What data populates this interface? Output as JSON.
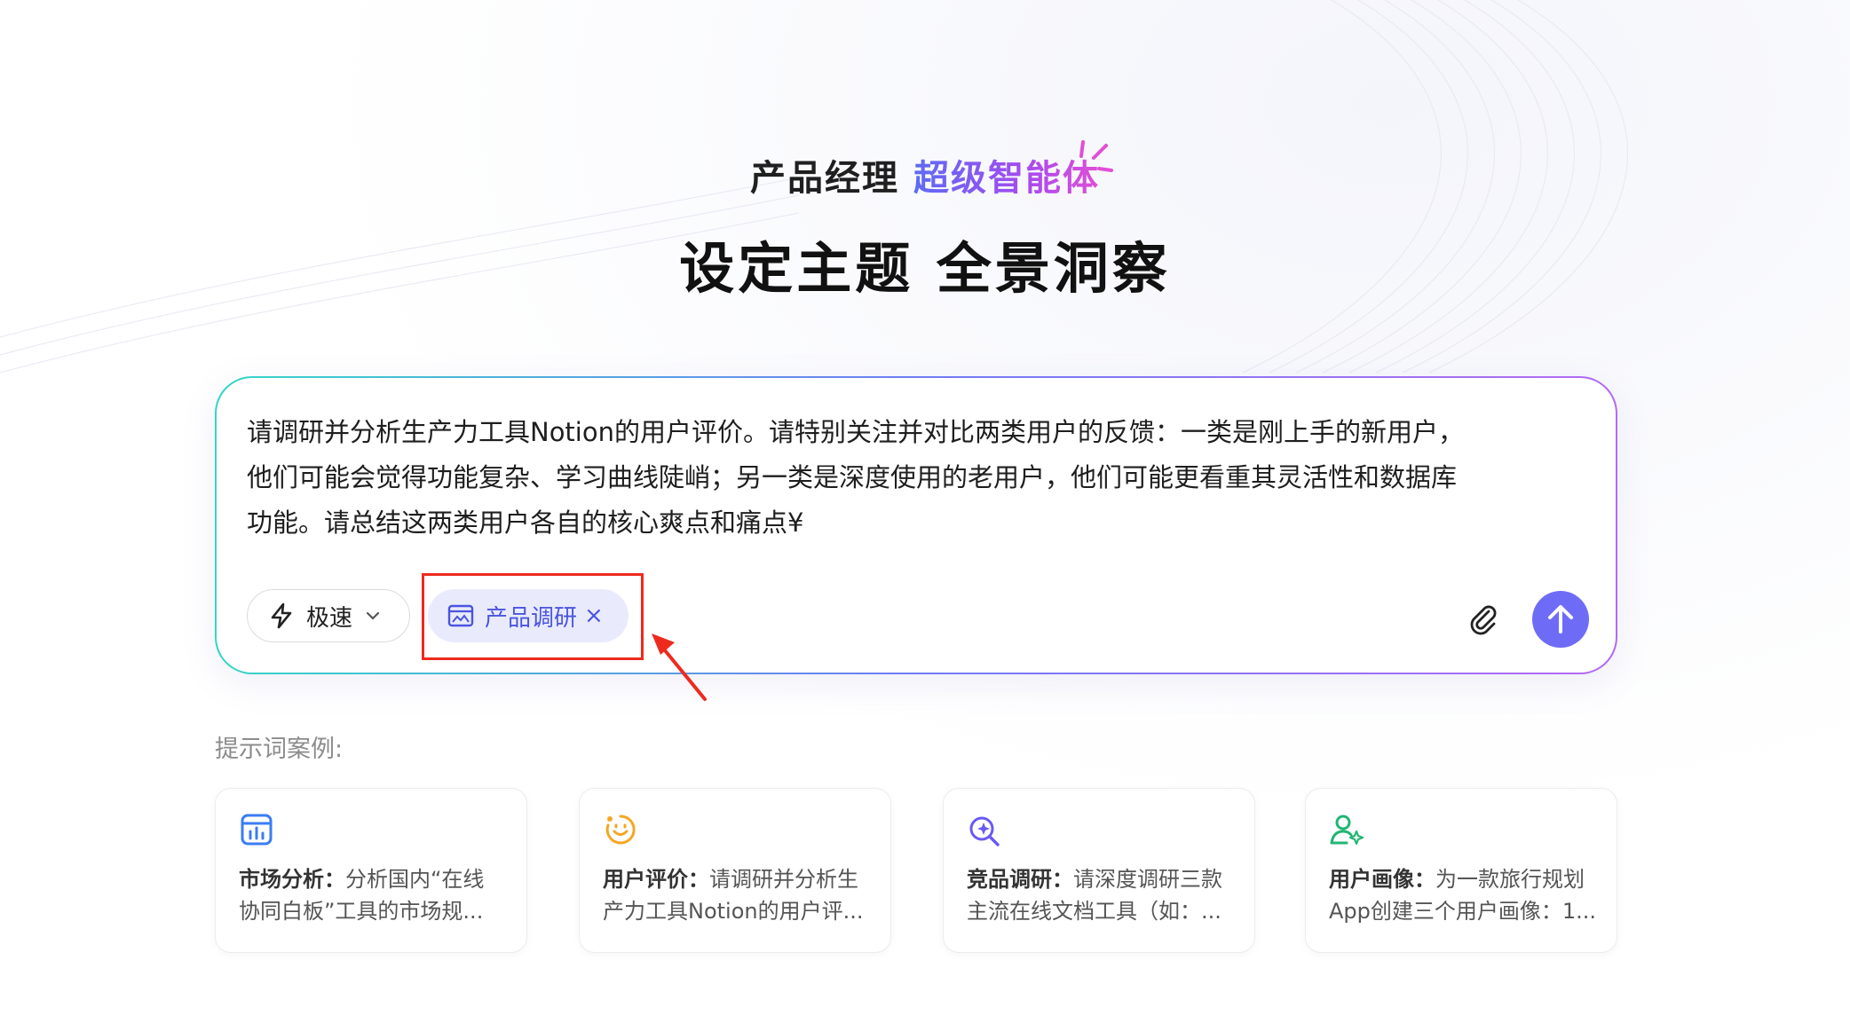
{
  "header": {
    "subtitle_plain": "产品经理",
    "subtitle_highlight": "超级智能体",
    "title": "设定主题 全景洞察"
  },
  "composer": {
    "prompt": "请调研并分析生产力工具Notion的用户评价。请特别关注并对比两类用户的反馈：一类是刚上手的新用户，\n他们可能会觉得功能复杂、学习曲线陡峭；另一类是深度使用的老用户，他们可能更看重其灵活性和数据库\n功能。请总结这两类用户各自的核心爽点和痛点¥",
    "mode_label": "极速",
    "mode_icon": "lightning-icon",
    "tag_label": "产品调研",
    "tag_close": "×",
    "tag_icon": "browser-window-icon",
    "attach_icon": "paperclip-icon",
    "send_icon": "arrow-up-icon",
    "send_color": "#6e6cf6"
  },
  "examples": {
    "label": "提示词案例:",
    "cards": [
      {
        "icon": "market-chart-icon",
        "icon_color": "#3a7cf5",
        "title": "市场分析：",
        "line1_rest": "分析国内“在线",
        "line2": "协同白板”工具的市场规..."
      },
      {
        "icon": "smile-face-icon",
        "icon_color": "#f5a623",
        "title": "用户评价：",
        "line1_rest": "请调研并分析生",
        "line2": "产力工具Notion的用户评..."
      },
      {
        "icon": "search-sparkle-icon",
        "icon_color": "#6a5af5",
        "title": "竞品调研：",
        "line1_rest": "请深度调研三款",
        "line2": "主流在线文档工具（如：..."
      },
      {
        "icon": "user-sparkle-icon",
        "icon_color": "#22b573",
        "title": "用户画像：",
        "line1_rest": "为一款旅行规划",
        "line2": "App创建三个用户画像：1...."
      }
    ]
  },
  "annotation": {
    "highlight_color": "#ee2a1f"
  }
}
